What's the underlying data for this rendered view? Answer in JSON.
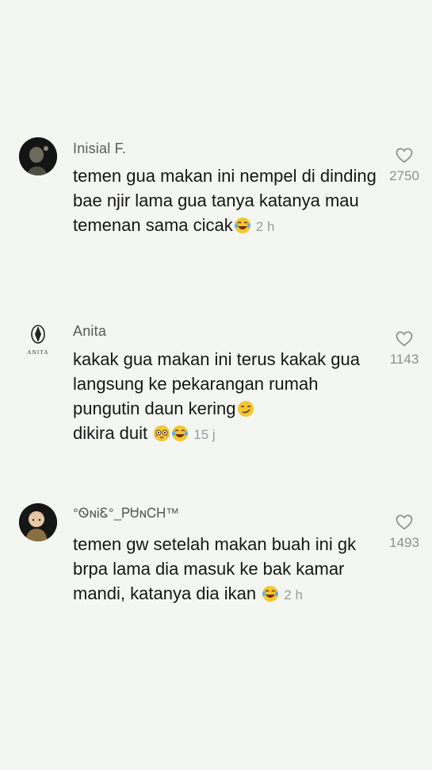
{
  "comments": [
    {
      "username": "Inisial F.",
      "text": "temen gua makan ini nempel di dinding bae njir lama gua tanya katanya mau temenan sama cicak",
      "emoji": "laughing-crying-emoji",
      "time": "2 h",
      "likes": "2750",
      "avatar": "dark-photo-avatar"
    },
    {
      "username": "Anita",
      "text": "kakak gua makan ini terus kakak gua langsung ke pekarangan rumah pungutin daun kering",
      "text2": "dikira duit",
      "emoji": "smirk-emoji",
      "emoji2": "flushed-emoji",
      "emoji3": "laughing-crying-emoji",
      "time": "15 j",
      "likes": "1143",
      "avatar_label": "ANITA"
    },
    {
      "username": "°ᏫɴᎥᏋ°_ᏢᏌɴᏟᎻ™",
      "text": "temen gw setelah makan buah ini gk brpa lama dia masuk ke bak kamar mandi, katanya dia ikan",
      "emoji": "laughing-crying-emoji",
      "time": "2 h",
      "likes": "1493",
      "avatar": "cartoon-avatar"
    }
  ]
}
